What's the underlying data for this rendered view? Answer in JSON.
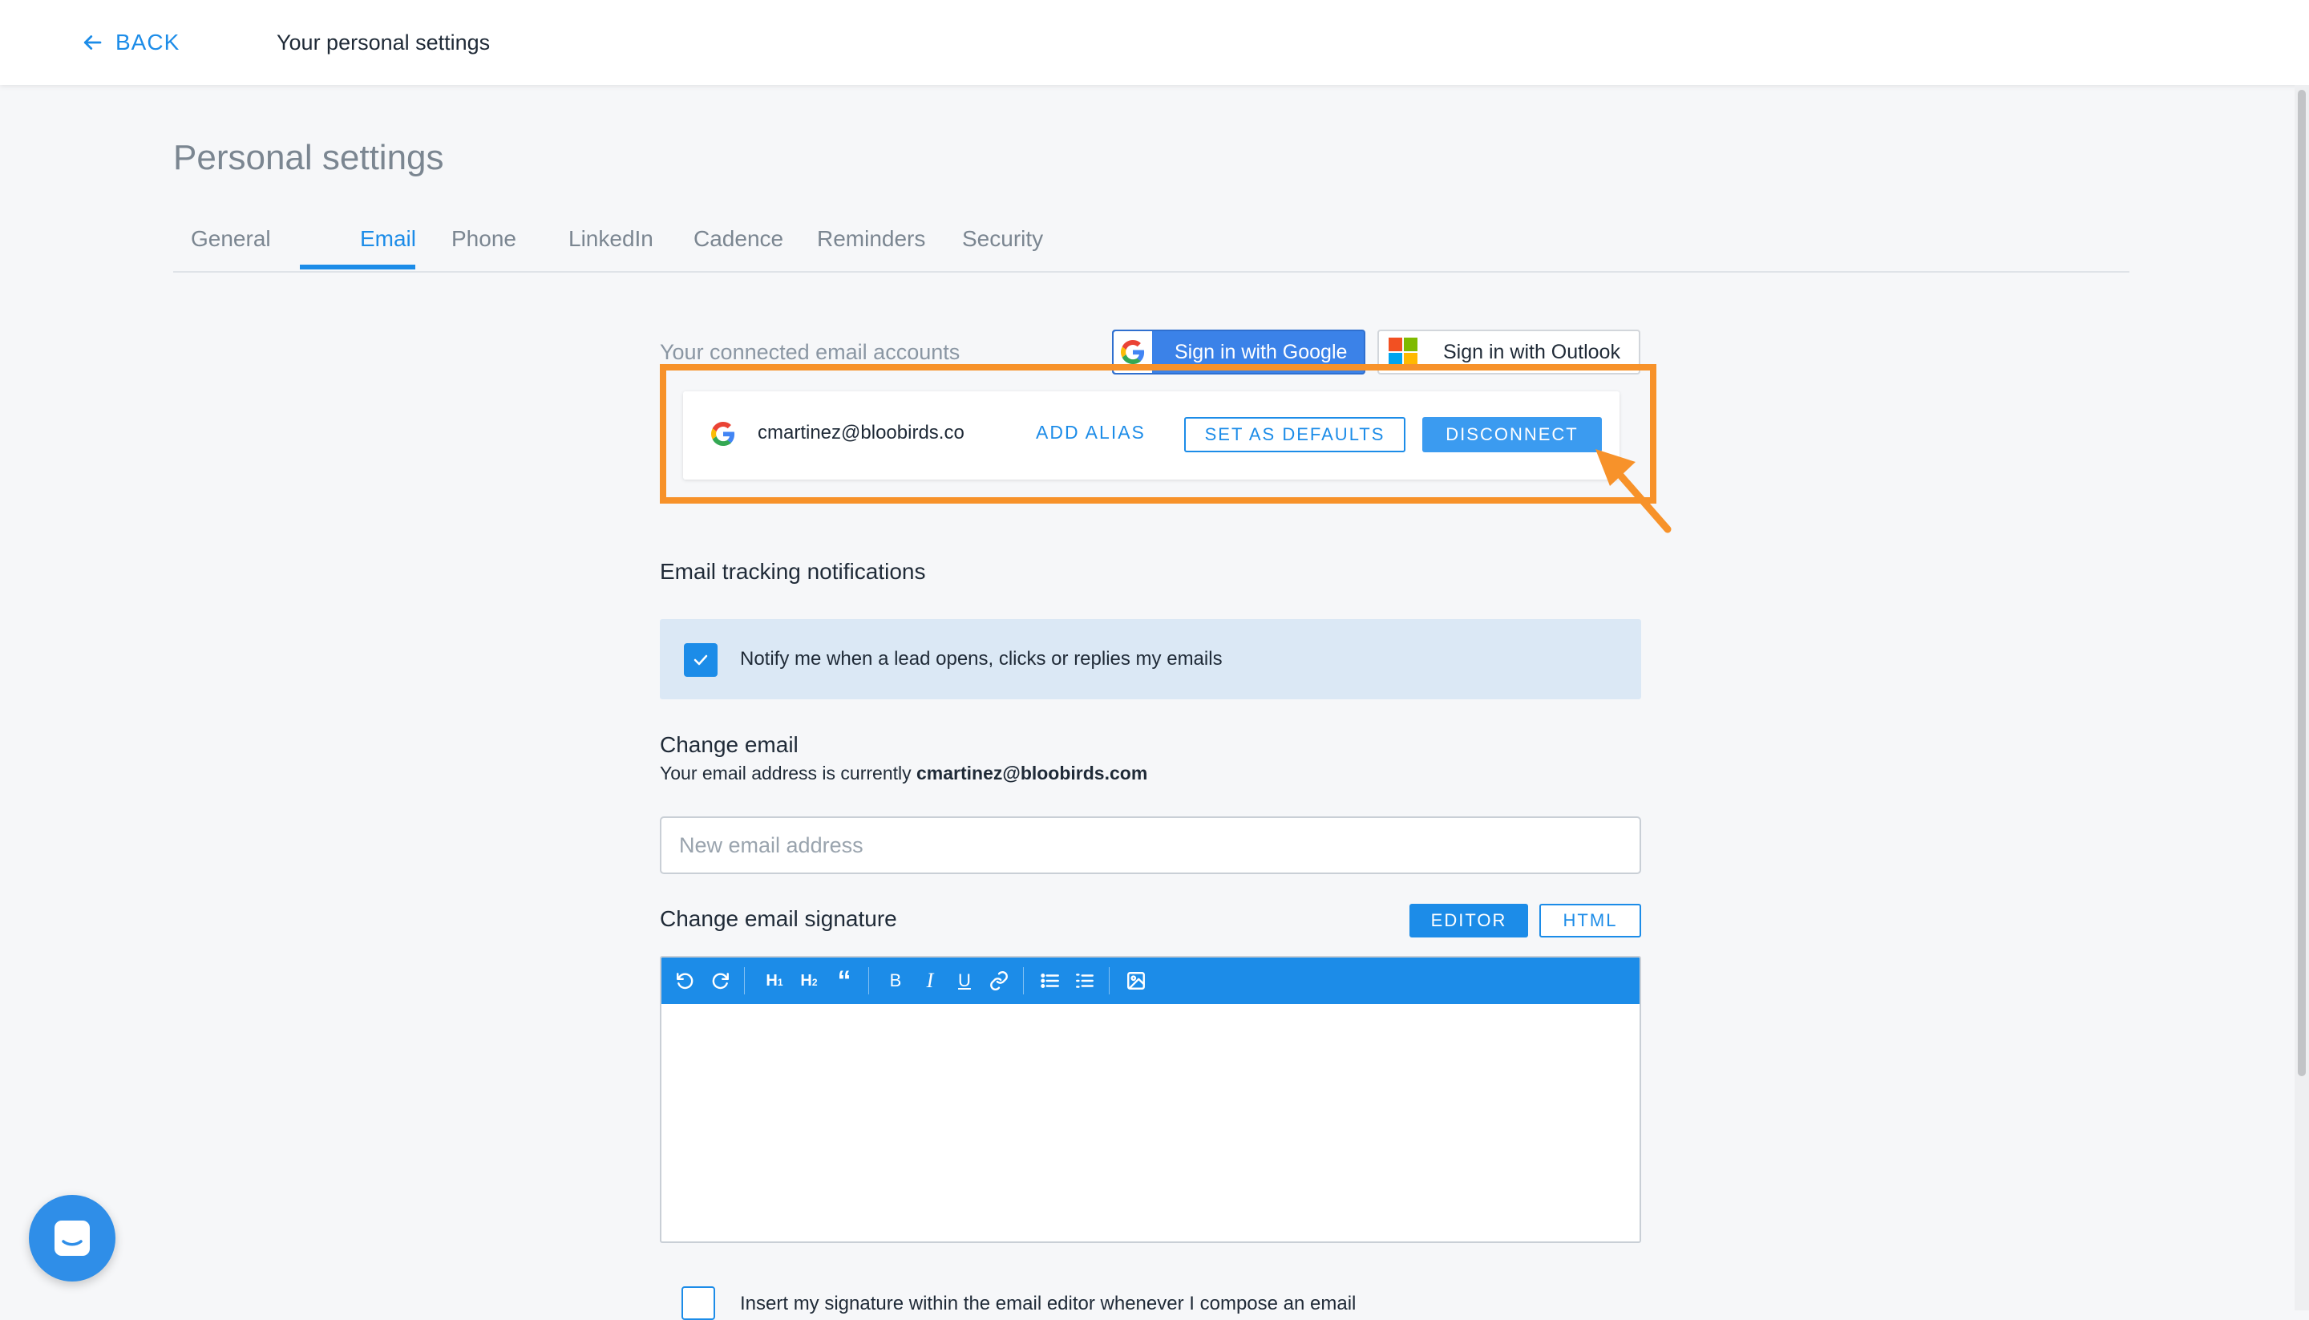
{
  "topbar": {
    "back_label": "BACK",
    "title": "Your personal settings"
  },
  "page": {
    "heading": "Personal settings"
  },
  "tabs": [
    {
      "label": "General",
      "active": false
    },
    {
      "label": "Email",
      "active": true
    },
    {
      "label": "Phone",
      "active": false
    },
    {
      "label": "LinkedIn",
      "active": false
    },
    {
      "label": "Cadence",
      "active": false
    },
    {
      "label": "Reminders",
      "active": false
    },
    {
      "label": "Security",
      "active": false
    }
  ],
  "connected": {
    "label": "Your connected email accounts",
    "google_button": "Sign in with Google",
    "outlook_button": "Sign in with Outlook",
    "account": {
      "email": "cmartinez@bloobirds.co",
      "add_alias": "ADD ALIAS",
      "set_defaults": "SET AS DEFAULTS",
      "disconnect": "DISCONNECT"
    }
  },
  "tracking": {
    "title": "Email tracking notifications",
    "option_label": "Notify me when a lead opens, clicks or replies my emails",
    "checked": true
  },
  "change_email": {
    "title": "Change email",
    "current_prefix": "Your email address is currently ",
    "current_email": "cmartinez@bloobirds.com",
    "placeholder": "New email address"
  },
  "signature": {
    "title": "Change email signature",
    "editor_button": "EDITOR",
    "html_button": "HTML",
    "toolbar": {
      "h1": "H",
      "h2": "H",
      "bold": "B",
      "italic": "I",
      "underline": "U"
    },
    "insert_label": "Insert my signature within the email editor whenever I compose an email"
  },
  "colors": {
    "accent": "#1c8ce8",
    "highlight": "#f7922a",
    "notify_bg": "#dbe8f5"
  }
}
